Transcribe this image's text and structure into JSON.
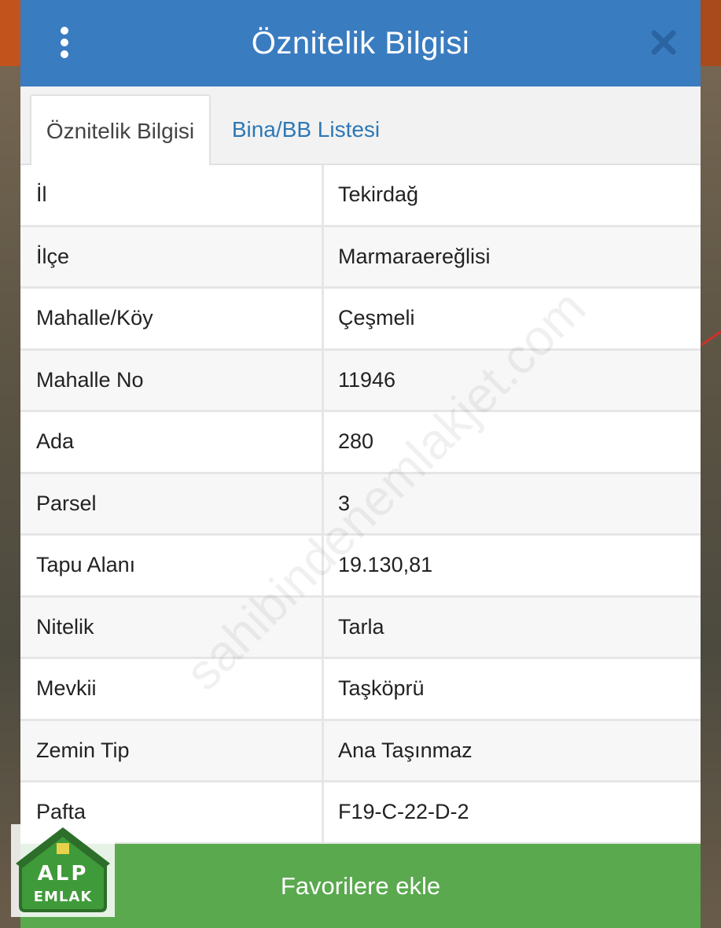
{
  "dialog": {
    "title": "Öznitelik Bilgisi",
    "menu_icon": "more-vertical-icon",
    "close_icon": "close-icon"
  },
  "tabs": [
    {
      "label": "Öznitelik Bilgisi",
      "active": true
    },
    {
      "label": "Bina/BB Listesi",
      "active": false
    }
  ],
  "attributes": [
    {
      "label": "İl",
      "value": "Tekirdağ"
    },
    {
      "label": "İlçe",
      "value": "Marmaraereğlisi"
    },
    {
      "label": "Mahalle/Köy",
      "value": "Çeşmeli"
    },
    {
      "label": "Mahalle No",
      "value": "11946"
    },
    {
      "label": "Ada",
      "value": "280"
    },
    {
      "label": "Parsel",
      "value": "3"
    },
    {
      "label": "Tapu Alanı",
      "value": "19.130,81"
    },
    {
      "label": "Nitelik",
      "value": "Tarla"
    },
    {
      "label": "Mevkii",
      "value": "Taşköprü"
    },
    {
      "label": "Zemin Tip",
      "value": "Ana Taşınmaz"
    },
    {
      "label": "Pafta",
      "value": "F19-C-22-D-2"
    }
  ],
  "favorite_button": {
    "label": "Favorilere ekle"
  },
  "watermark": {
    "text": "sahibindenemlakjet.com"
  },
  "logo": {
    "line1": "ALP",
    "line2": "EMLAK"
  },
  "colors": {
    "header": "#3a7cc0",
    "tab_link": "#2d78b6",
    "button": "#5aa94f",
    "logo_green": "#3f9a3a"
  }
}
